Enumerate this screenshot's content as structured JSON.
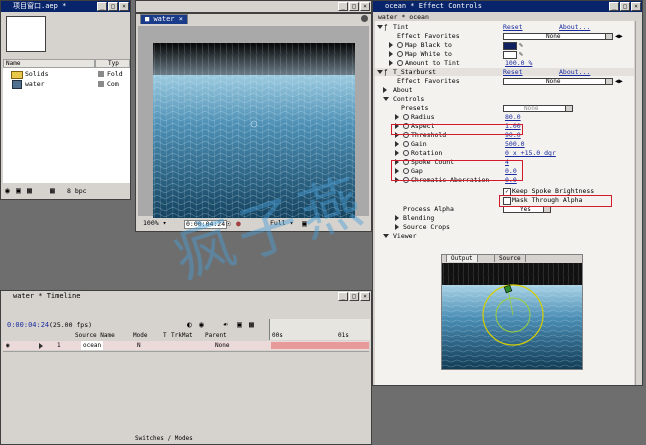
{
  "project_window": {
    "title": "项目窗口.aep *",
    "columns": {
      "name": "Name",
      "type": "Typ"
    },
    "items": [
      {
        "name": "Solids",
        "type": "Fold"
      },
      {
        "name": "water",
        "type": "Com"
      }
    ],
    "footer_bpc": "8 bpc"
  },
  "comp_window": {
    "tab": "water",
    "zoom": "100%",
    "timecode": "0:00:04:24",
    "resolution": "Full"
  },
  "effect_controls": {
    "title": "ocean * Effect Controls",
    "breadcrumb": "water * ocean",
    "tint": {
      "name": "Tint",
      "reset": "Reset",
      "about": "About...",
      "favorites_label": "Effect Favorites",
      "favorites_value": "None",
      "map_black": "Map Black to",
      "map_white": "Map White to",
      "amount_label": "Amount to Tint",
      "amount_value": "100.0 %",
      "black_color": "#102060",
      "white_color": "#ffffff"
    },
    "starburst": {
      "name": "T_Starburst",
      "reset": "Reset",
      "about": "About...",
      "favorites_label": "Effect Favorites",
      "favorites_value": "None",
      "about_row": "About",
      "controls": "Controls",
      "presets_label": "Presets",
      "presets_value": "None",
      "radius_label": "Radius",
      "radius_value": "80.0",
      "aspect_label": "Aspect",
      "aspect_value": "1.00",
      "threshold_label": "Threshold",
      "threshold_value": "90.0",
      "gain_label": "Gain",
      "gain_value": "500.0",
      "rotation_label": "Rotation",
      "rotation_value": "0 x +15.0 dgr",
      "spoke_label": "Spoke Count",
      "spoke_value": "4",
      "gap_label": "Gap",
      "gap_value": "0.0",
      "chroma_label": "Chromatic Aberration",
      "chroma_value": "0.0",
      "keep_spoke": "Keep Spoke Brightness",
      "mask_through": "Mask Through Alpha",
      "process_alpha_label": "Process Alpha",
      "process_alpha_value": "Yes",
      "blending": "Blending",
      "source_crops": "Source Crops",
      "viewer": "Viewer",
      "viewer_tabs": [
        "Output",
        "Source"
      ]
    }
  },
  "timeline": {
    "title": "water * Timeline",
    "timecode": "0:00:04:24",
    "fps": "(25.00 fps)",
    "columns": [
      "Source Name",
      "Mode",
      "T",
      "TrkMat",
      "Parent"
    ],
    "layer": {
      "num": "1",
      "name": "ocean",
      "mode": "N",
      "parent": "None"
    },
    "ruler": [
      "00s",
      "01s"
    ],
    "footer": "Switches / Modes"
  },
  "watermark": "疯子燕"
}
